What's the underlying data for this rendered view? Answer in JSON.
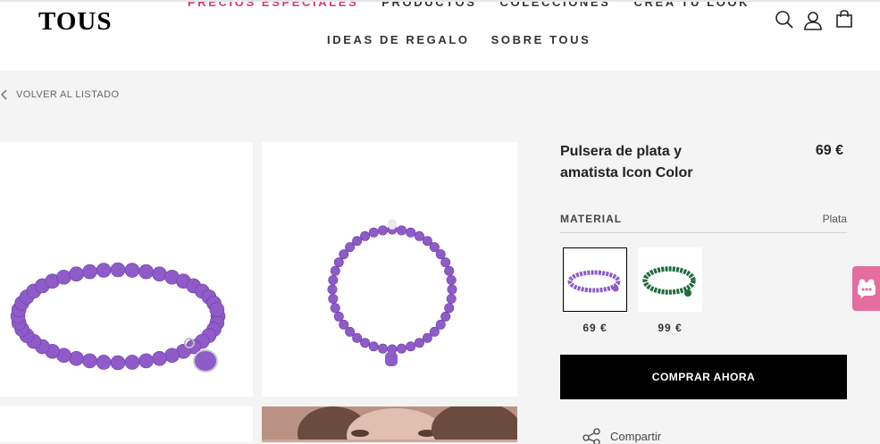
{
  "brand": {
    "logo_text": "TOUS"
  },
  "nav": {
    "row1": [
      "PRECIOS ESPECIALES",
      "PRODUCTOS",
      "COLECCIONES",
      "CREA TU LOOK"
    ],
    "row2": [
      "IDEAS DE REGALO",
      "SOBRE TOUS"
    ]
  },
  "header_icons": [
    "search-icon",
    "user-icon",
    "bag-icon"
  ],
  "breadcrumb": {
    "back_label": "VOLVER AL LISTADO"
  },
  "product": {
    "title": "Pulsera de plata y amatista Icon Color",
    "price": "69 €",
    "material_label": "MATERIAL",
    "material_value": "Plata",
    "variants": [
      {
        "price": "69 €",
        "color": "#8e5bc8",
        "selected": true
      },
      {
        "price": "99 €",
        "color": "#1f6b3d",
        "selected": false
      }
    ],
    "buy_label": "COMPRAR AHORA",
    "share_label": "Compartir"
  },
  "colors": {
    "accent_pink": "#d33a74",
    "chat_bg": "#e46ea0",
    "amethyst": "#8e5bc8",
    "malachite": "#1f6b3d"
  }
}
